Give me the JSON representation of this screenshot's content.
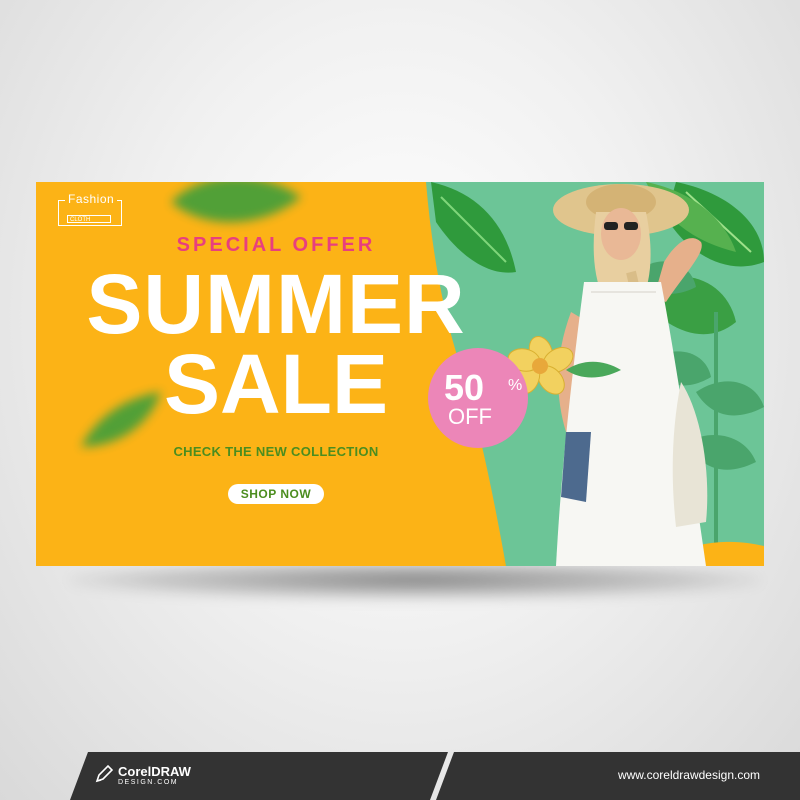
{
  "banner": {
    "logo_main": "Fashion",
    "logo_sub": "CLOTH",
    "special_offer": "SPECIAL OFFER",
    "headline_line1": "SUMMER",
    "headline_line2": "SALE",
    "tagline": "CHECK THE NEW COLLECTION",
    "cta_label": "SHOP NOW",
    "discount_value": "50",
    "discount_symbol": "%",
    "discount_off": "OFF"
  },
  "footer": {
    "brand_name": "CorelDRAW",
    "brand_sub": "DESIGN.COM",
    "website": "www.coreldrawdesign.com"
  },
  "colors": {
    "banner_bg": "#fcb316",
    "panel_green": "#6cc597",
    "accent_pink": "#e83f7e",
    "badge_pink": "#ec86b8",
    "text_green": "#4b8d1f",
    "footer_dark": "#333333"
  },
  "icons": {
    "footer_logo": "pencil-icon",
    "decor_leaf": "monstera-leaf-icon",
    "decor_flower": "flower-icon"
  }
}
